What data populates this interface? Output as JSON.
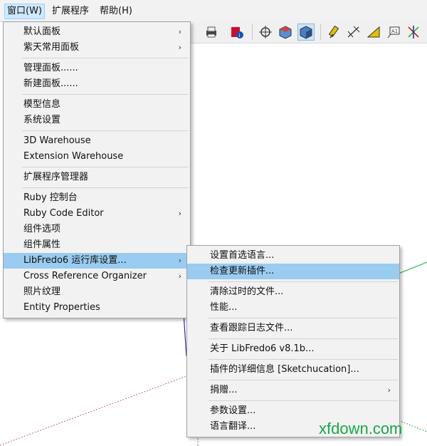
{
  "menubar": {
    "items": [
      {
        "label": "窗口(W)"
      },
      {
        "label": "扩展程序"
      },
      {
        "label": "帮助(H)"
      }
    ]
  },
  "toolbar": {
    "icons": [
      "print-icon",
      "model-info-icon",
      "camera-orbit-icon",
      "iso-view-icon",
      "standard-views-icon",
      "tape-measure-icon",
      "dimension-icon",
      "protractor-icon",
      "text-label-icon",
      "axes-icon"
    ]
  },
  "window_menu": {
    "groups": [
      [
        {
          "label": "默认面板",
          "submenu": true
        },
        {
          "label": "紫天常用面板",
          "submenu": true
        }
      ],
      [
        {
          "label": "管理面板......"
        },
        {
          "label": "新建面板......"
        }
      ],
      [
        {
          "label": "模型信息"
        },
        {
          "label": "系统设置"
        }
      ],
      [
        {
          "label": "3D Warehouse"
        },
        {
          "label": "Extension Warehouse"
        }
      ],
      [
        {
          "label": "扩展程序管理器"
        }
      ],
      [
        {
          "label": "Ruby 控制台"
        },
        {
          "label": "Ruby Code Editor",
          "submenu": true
        },
        {
          "label": "组件选项"
        },
        {
          "label": "组件属性"
        },
        {
          "label": "LibFredo6 运行库设置...",
          "submenu": true,
          "highlighted": true
        },
        {
          "label": "Cross Reference Organizer",
          "submenu": true
        },
        {
          "label": "照片纹理"
        },
        {
          "label": "Entity Properties"
        }
      ]
    ]
  },
  "libfredo_submenu": {
    "groups": [
      [
        {
          "label": "设置首选语言..."
        },
        {
          "label": "检查更新插件...",
          "highlighted": true
        }
      ],
      [
        {
          "label": "清除过时的文件..."
        },
        {
          "label": "性能..."
        }
      ],
      [
        {
          "label": "查看跟踪日志文件..."
        }
      ],
      [
        {
          "label": "关于 LibFredo6 v8.1b..."
        }
      ],
      [
        {
          "label": "插件的详细信息 [Sketchucation]..."
        }
      ],
      [
        {
          "label": "捐赠...",
          "submenu": true
        }
      ],
      [
        {
          "label": "参数设置..."
        },
        {
          "label": "语言翻译..."
        }
      ]
    ]
  },
  "watermark": "xfdown.com",
  "colors": {
    "highlight": "#99ccf0",
    "menu_bg": "#f2f2f2",
    "watermark": "#1aa64a"
  }
}
